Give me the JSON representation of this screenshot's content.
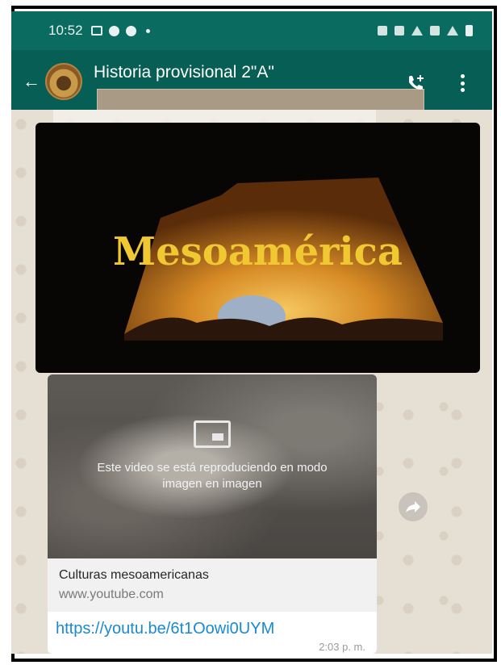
{
  "status_bar": {
    "time": "10:52"
  },
  "app_bar": {
    "title": "Historia provisional 2\"A\""
  },
  "hero_image": {
    "title": "Mesoamérica"
  },
  "video": {
    "pip_message": "Este video se está reproduciendo en modo imagen en imagen",
    "link_title": "Culturas mesoamericanas",
    "link_domain": "www.youtube.com",
    "url": "https://youtu.be/6t1Oowi0UYM",
    "time": "2:03 p. m."
  },
  "colors": {
    "header": "#075e54",
    "status_bar": "#0a6b60",
    "link": "#1a8ad0",
    "hero_text": "#f0c832"
  }
}
